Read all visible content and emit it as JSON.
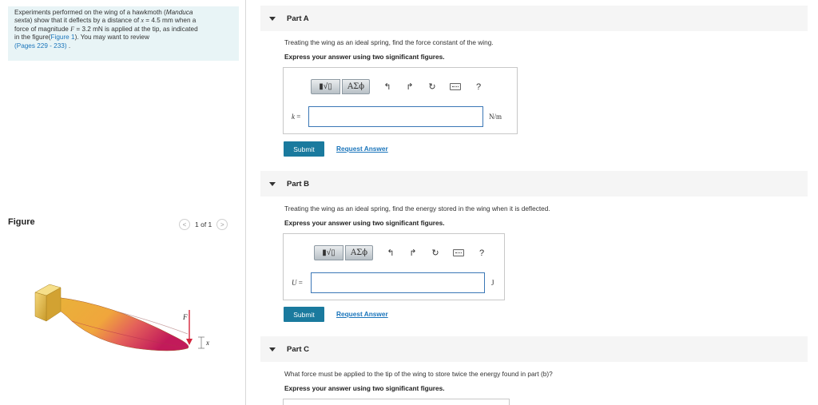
{
  "problem": {
    "line1": "Experiments performed on the wing of a hawkmoth (",
    "species": "Manduca",
    "line2a": "sexta",
    "line2b": ") show that it deflects by a distance of ",
    "x_sym": "x",
    "x_val": " = 4.5 mm when a",
    "line3a": "force of magnitude ",
    "f_sym": "F",
    "f_val": " = 3.2 mN is applied at the tip, as indicated",
    "line4a": "in the figure(",
    "figure_link": "Figure 1",
    "line4b": "). You may want to review",
    "pages_link": "(Pages 229 - 233)",
    "pages_end": " ."
  },
  "figure": {
    "label": "Figure",
    "pager_text": "1 of 1",
    "prev": "<",
    "next": ">",
    "force_label": "F",
    "x_label": "x"
  },
  "toolbar": {
    "templates": "▮√▯",
    "symbols": "ΑΣϕ",
    "undo": "↰",
    "redo": "↱",
    "reset": "↻",
    "help": "?"
  },
  "parts": [
    {
      "title": "Part A",
      "question": "Treating the wing as an ideal spring, find the force constant of the wing.",
      "instruction": "Express your answer using two significant figures.",
      "var": "k",
      "eq": " =",
      "unit": "N/m",
      "submit": "Submit",
      "request": "Request Answer"
    },
    {
      "title": "Part B",
      "question": "Treating the wing as an ideal spring, find the energy stored in the wing when it is deflected.",
      "instruction": "Express your answer using two significant figures.",
      "var": "U",
      "eq": " =",
      "unit": "J",
      "submit": "Submit",
      "request": "Request Answer"
    },
    {
      "title": "Part C",
      "question": "What force must be applied to the tip of the wing to store twice the energy found in part (b)?",
      "instruction": "Express your answer using two significant figures."
    }
  ]
}
